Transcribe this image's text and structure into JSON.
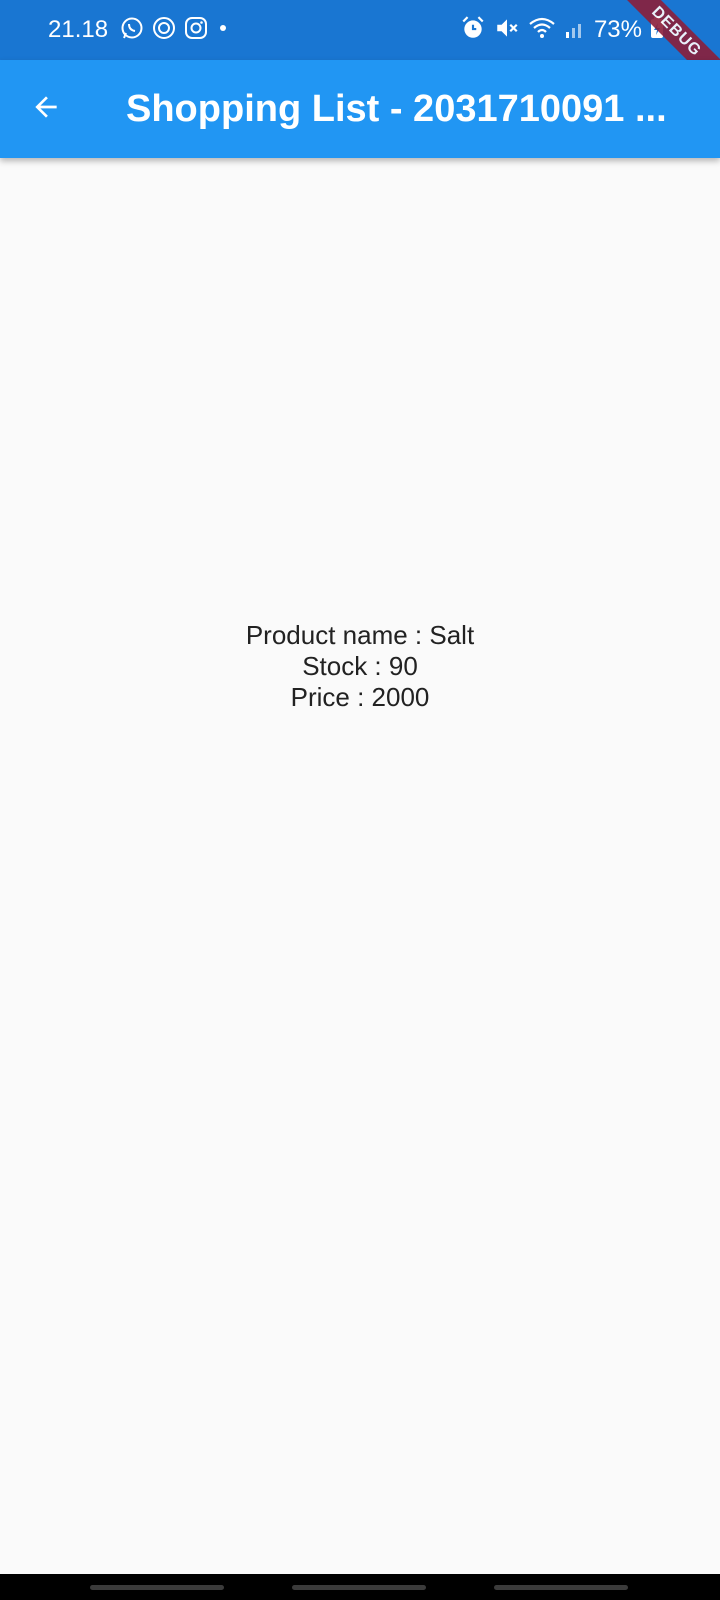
{
  "status_bar": {
    "time": "21.18",
    "left_icons": [
      "whatsapp-icon",
      "notification-badge-icon",
      "instagram-icon",
      "dot-icon"
    ],
    "right_icons": [
      "alarm-icon",
      "mute-icon",
      "wifi-icon",
      "signal-icon"
    ],
    "battery_percent": "73%"
  },
  "app_bar": {
    "title": "Shopping List - 2031710091 ...",
    "back_icon": "arrow-back-icon",
    "color": "#2196f3"
  },
  "debug_banner": "DEBUG",
  "product": {
    "name_line": "Product name : Salt",
    "stock_line": "Stock : 90",
    "price_line": "Price : 2000"
  }
}
